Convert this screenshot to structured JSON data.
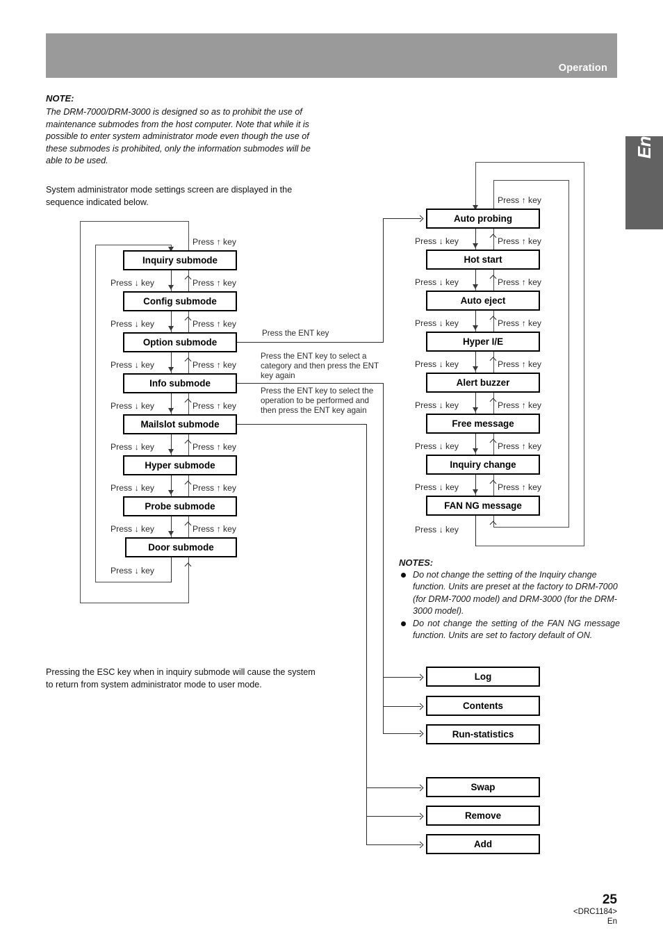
{
  "header": {
    "title": "Operation"
  },
  "side_tab": {
    "label": "English"
  },
  "note": {
    "heading": "NOTE:",
    "body": "The DRM-7000/DRM-3000 is designed so as to prohibit the use of maintenance submodes from the host computer. Note that while it is possible to enter system administrator mode even though the use of these submodes is prohibited, only the information submodes will be able to be used."
  },
  "sequence_intro": "System administrator mode settings screen are displayed in the sequence indicated below.",
  "esc_note": "Pressing the ESC key when in inquiry submode will cause the system to return from system administrator mode to user mode.",
  "key_labels": {
    "press_up": "Press ↑ key",
    "press_down": "Press ↓ key",
    "press_up_prefix": "Press ",
    "press_up_suffix": " key",
    "up_arrow": "↑",
    "down_arrow": "↓"
  },
  "left_column": {
    "nodes": [
      {
        "label": "Inquiry submode"
      },
      {
        "label": "Config submode"
      },
      {
        "label": "Option submode"
      },
      {
        "label": "Info submode"
      },
      {
        "label": "Mailslot submode"
      },
      {
        "label": "Hyper submode"
      },
      {
        "label": "Probe submode"
      },
      {
        "label": "Door submode"
      }
    ]
  },
  "right_column": {
    "nodes": [
      {
        "label": "Auto probing"
      },
      {
        "label": "Hot start"
      },
      {
        "label": "Auto eject"
      },
      {
        "label": "Hyper I/E"
      },
      {
        "label": "Alert buzzer"
      },
      {
        "label": "Free message"
      },
      {
        "label": "Inquiry change"
      },
      {
        "label": "FAN NG message"
      }
    ]
  },
  "ent_annotations": [
    {
      "text": "Press the ENT key"
    },
    {
      "text": "Press the ENT key to select a category and then press the ENT key again"
    },
    {
      "text": "Press the ENT key to select the operation to be performed and then press the ENT key again"
    }
  ],
  "info_group": {
    "nodes": [
      {
        "label": "Log"
      },
      {
        "label": "Contents"
      },
      {
        "label": "Run-statistics"
      }
    ]
  },
  "mailslot_group": {
    "nodes": [
      {
        "label": "Swap"
      },
      {
        "label": "Remove"
      },
      {
        "label": "Add"
      }
    ]
  },
  "notes": {
    "heading": "NOTES:",
    "items": [
      "Do not change the setting of the Inquiry change function. Units are preset at the factory to DRM-7000 (for DRM-7000 model) and DRM-3000 (for the DRM-3000 model).",
      "Do not change the setting of the FAN NG message function. Units are set to factory default of ON."
    ]
  },
  "footer": {
    "page_number": "25",
    "doc_code": "<DRC1184>",
    "lang_code": "En"
  },
  "colors": {
    "header_gray": "#9a9a9a",
    "tab_gray": "#626262",
    "line": "#4a4a4a",
    "text": "#111111"
  }
}
